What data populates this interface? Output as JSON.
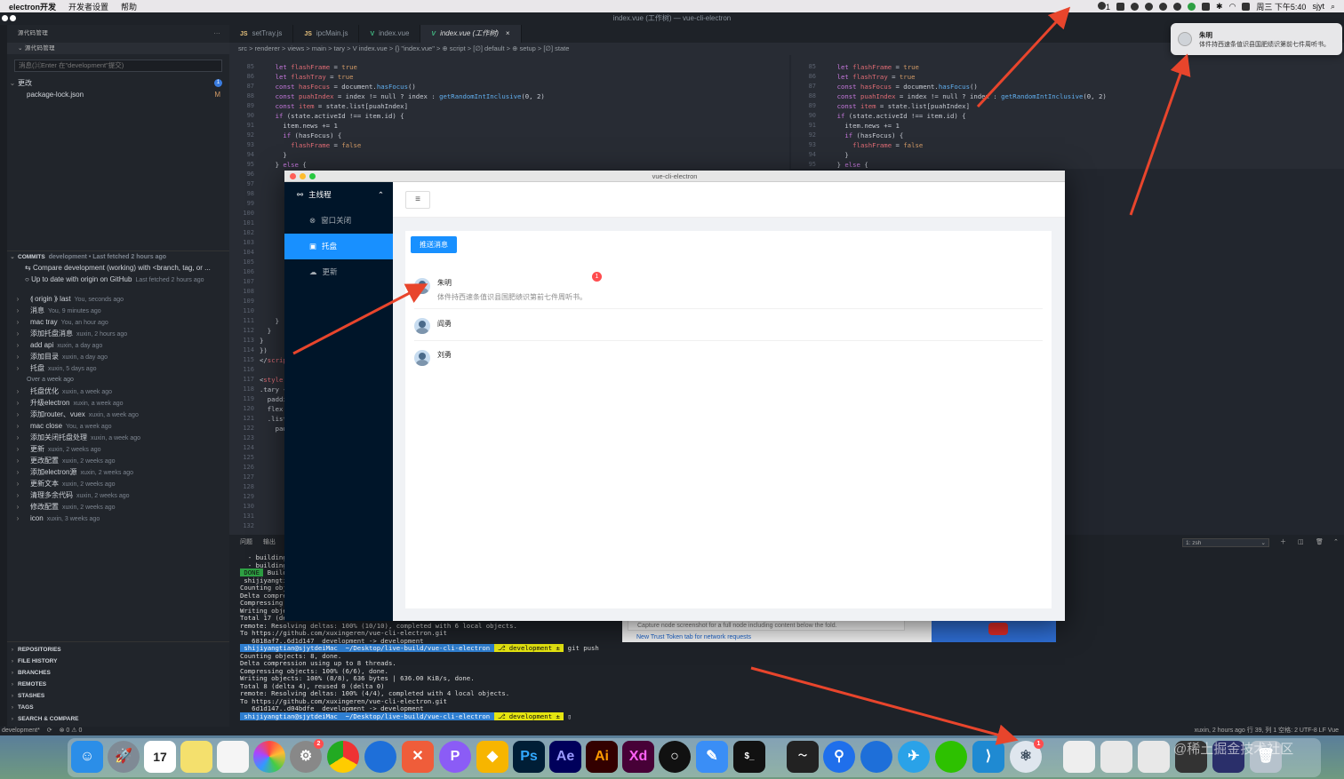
{
  "menubar": {
    "app": "electron开发",
    "items": [
      "开发者设置",
      "帮助"
    ],
    "badge_count": "1",
    "clock": "周三 下午5:40",
    "user": "sjyt"
  },
  "vscode": {
    "window_title": "index.vue (工作树) — vue-cli-electron",
    "tabs": [
      {
        "icon": "JS",
        "label": "setTray.js"
      },
      {
        "icon": "JS",
        "label": "ipcMain.js"
      },
      {
        "icon": "V",
        "label": "index.vue"
      },
      {
        "icon": "V",
        "label": "index.vue (工作树)",
        "active": true
      }
    ],
    "breadcrumb": "src > renderer > views > main > tary > V index.vue > {} \"index.vue\" > ⊕ script > [∅] default > ⊕ setup > [∅] state",
    "sidebar": {
      "header": "源代码管理",
      "section": "源代码管理",
      "input_placeholder": "消息(⌘Enter 在\"development\"提交)",
      "changes_label": "更改",
      "changes_count": "1",
      "changed_file": "package-lock.json",
      "changed_status": "M",
      "commits_header": "COMMITS",
      "commits_meta": "development • Last fetched 2 hours ago",
      "compare_row": "Compare development (working) with <branch, tag, or ...",
      "uptodate_row": "Up to date with origin on GitHub",
      "uptodate_meta": "Last fetched 2 hours ago",
      "commits": [
        {
          "msg": "⟬ origin ⟫ last",
          "meta": "You, seconds ago"
        },
        {
          "msg": "消息",
          "meta": "You, 9 minutes ago"
        },
        {
          "msg": "mac tray",
          "meta": "You, an hour ago"
        },
        {
          "msg": "添加托盘消息",
          "meta": "xuxin, 2 hours ago"
        },
        {
          "msg": "add api",
          "meta": "xuxin, a day ago"
        },
        {
          "msg": "添加目录",
          "meta": "xuxin, a day ago"
        },
        {
          "msg": "托盘",
          "meta": "xuxin, 5 days ago"
        }
      ],
      "older_label": "Over a week ago",
      "older_commits": [
        {
          "msg": "托盘优化",
          "meta": "xuxin, a week ago"
        },
        {
          "msg": "升级electron",
          "meta": "xuxin, a week ago"
        },
        {
          "msg": "添加router、vuex",
          "meta": "xuxin, a week ago"
        },
        {
          "msg": "mac close",
          "meta": "You, a week ago"
        },
        {
          "msg": "添加关闭托盘处理",
          "meta": "xuxin, a week ago"
        },
        {
          "msg": "更新",
          "meta": "xuxin, 2 weeks ago"
        },
        {
          "msg": "更改配置",
          "meta": "xuxin, 2 weeks ago"
        },
        {
          "msg": "添加electron源",
          "meta": "xuxin, 2 weeks ago"
        },
        {
          "msg": "更新文本",
          "meta": "xuxin, 2 weeks ago"
        },
        {
          "msg": "清理多余代码",
          "meta": "xuxin, 2 weeks ago"
        },
        {
          "msg": "修改配置",
          "meta": "xuxin, 2 weeks ago"
        },
        {
          "msg": "icon",
          "meta": "xuxin, 3 weeks ago"
        }
      ],
      "bottom_sections": [
        "REPOSITORIES",
        "FILE HISTORY",
        "BRANCHES",
        "REMOTES",
        "STASHES",
        "TAGS",
        "SEARCH & COMPARE"
      ]
    },
    "panel": {
      "tabs": [
        "问题",
        "输出"
      ],
      "terminal_select": "1: zsh"
    },
    "statusbar": {
      "branch": "development*",
      "errors": "⊗ 0 ⚠ 0",
      "right": "xuxin, 2 hours ago   行 39, 列 1   空格: 2   UTF-8   LF   Vue"
    }
  },
  "electron": {
    "title": "vue-cli-electron",
    "menu_group": "主线程",
    "menu_items": [
      {
        "label": "窗口关闭",
        "icon": "close-circle-icon"
      },
      {
        "label": "托盘",
        "icon": "tray-icon",
        "selected": true
      },
      {
        "label": "更新",
        "icon": "cloud-icon"
      }
    ],
    "fold_icon": "≡",
    "push_button": "推送消息",
    "messages": [
      {
        "name": "朱明",
        "desc": "体件持西速条值识县国肥绩识第前七件周听书。",
        "badge": "1"
      },
      {
        "name": "阎勇",
        "desc": ""
      },
      {
        "name": "刘勇",
        "desc": ""
      }
    ]
  },
  "notification": {
    "title": "朱明",
    "body": "体件持西速条值识县国肥绩识第前七件周听书。"
  },
  "browser": {
    "line1": "Capture node screenshot for a full node including content below the fold.",
    "line2": "New Trust Token tab for network requests"
  },
  "dock": {
    "calendar_day": "17",
    "settings_badge": "2",
    "app_badge": "1",
    "labels": [
      "Ps",
      "Ae",
      "Ai",
      "Xd"
    ]
  },
  "watermark": "@稀土掘金技术社区"
}
